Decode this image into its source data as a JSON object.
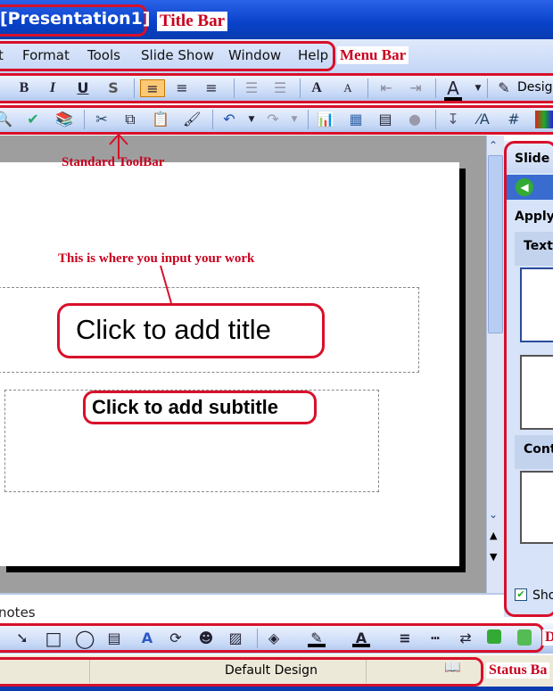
{
  "title_bar": {
    "title": "[Presentation1]",
    "annotation": "Title Bar"
  },
  "menu_bar": {
    "items": [
      "t",
      "Format",
      "Tools",
      "Slide Show",
      "Window",
      "Help"
    ],
    "annotation": "Menu Bar"
  },
  "formatting_toolbar": {
    "buttons": [
      "bold",
      "italic",
      "underline",
      "shadow",
      "align-left",
      "center",
      "align-right",
      "numbering",
      "bullets",
      "increase-font",
      "decrease-font",
      "decrease-indent",
      "increase-indent",
      "font-color"
    ],
    "bold": "B",
    "italic": "I",
    "underline": "U",
    "shadow": "S",
    "font_color": "A",
    "design_label": "Design"
  },
  "standard_toolbar": {
    "annotation": "Standard ToolBar"
  },
  "slide": {
    "annotation": "This is where you input your work",
    "title_placeholder": "Click to add title",
    "subtitle_placeholder": "Click to add subtitle"
  },
  "task_pane": {
    "title": "Slide",
    "apply_label": "Apply",
    "section_text": "Text",
    "section_content": "Cont",
    "show_label": "Sho"
  },
  "notes": {
    "placeholder": "notes"
  },
  "drawing_toolbar": {
    "annotation": "D"
  },
  "status_bar": {
    "design": "Default Design",
    "annotation": "Status Ba"
  },
  "colors": {
    "title_bar": "#0842c8",
    "annotation_red": "#d8102a",
    "toolbar": "#c6d8f6",
    "status_bar": "#ece9d8"
  }
}
